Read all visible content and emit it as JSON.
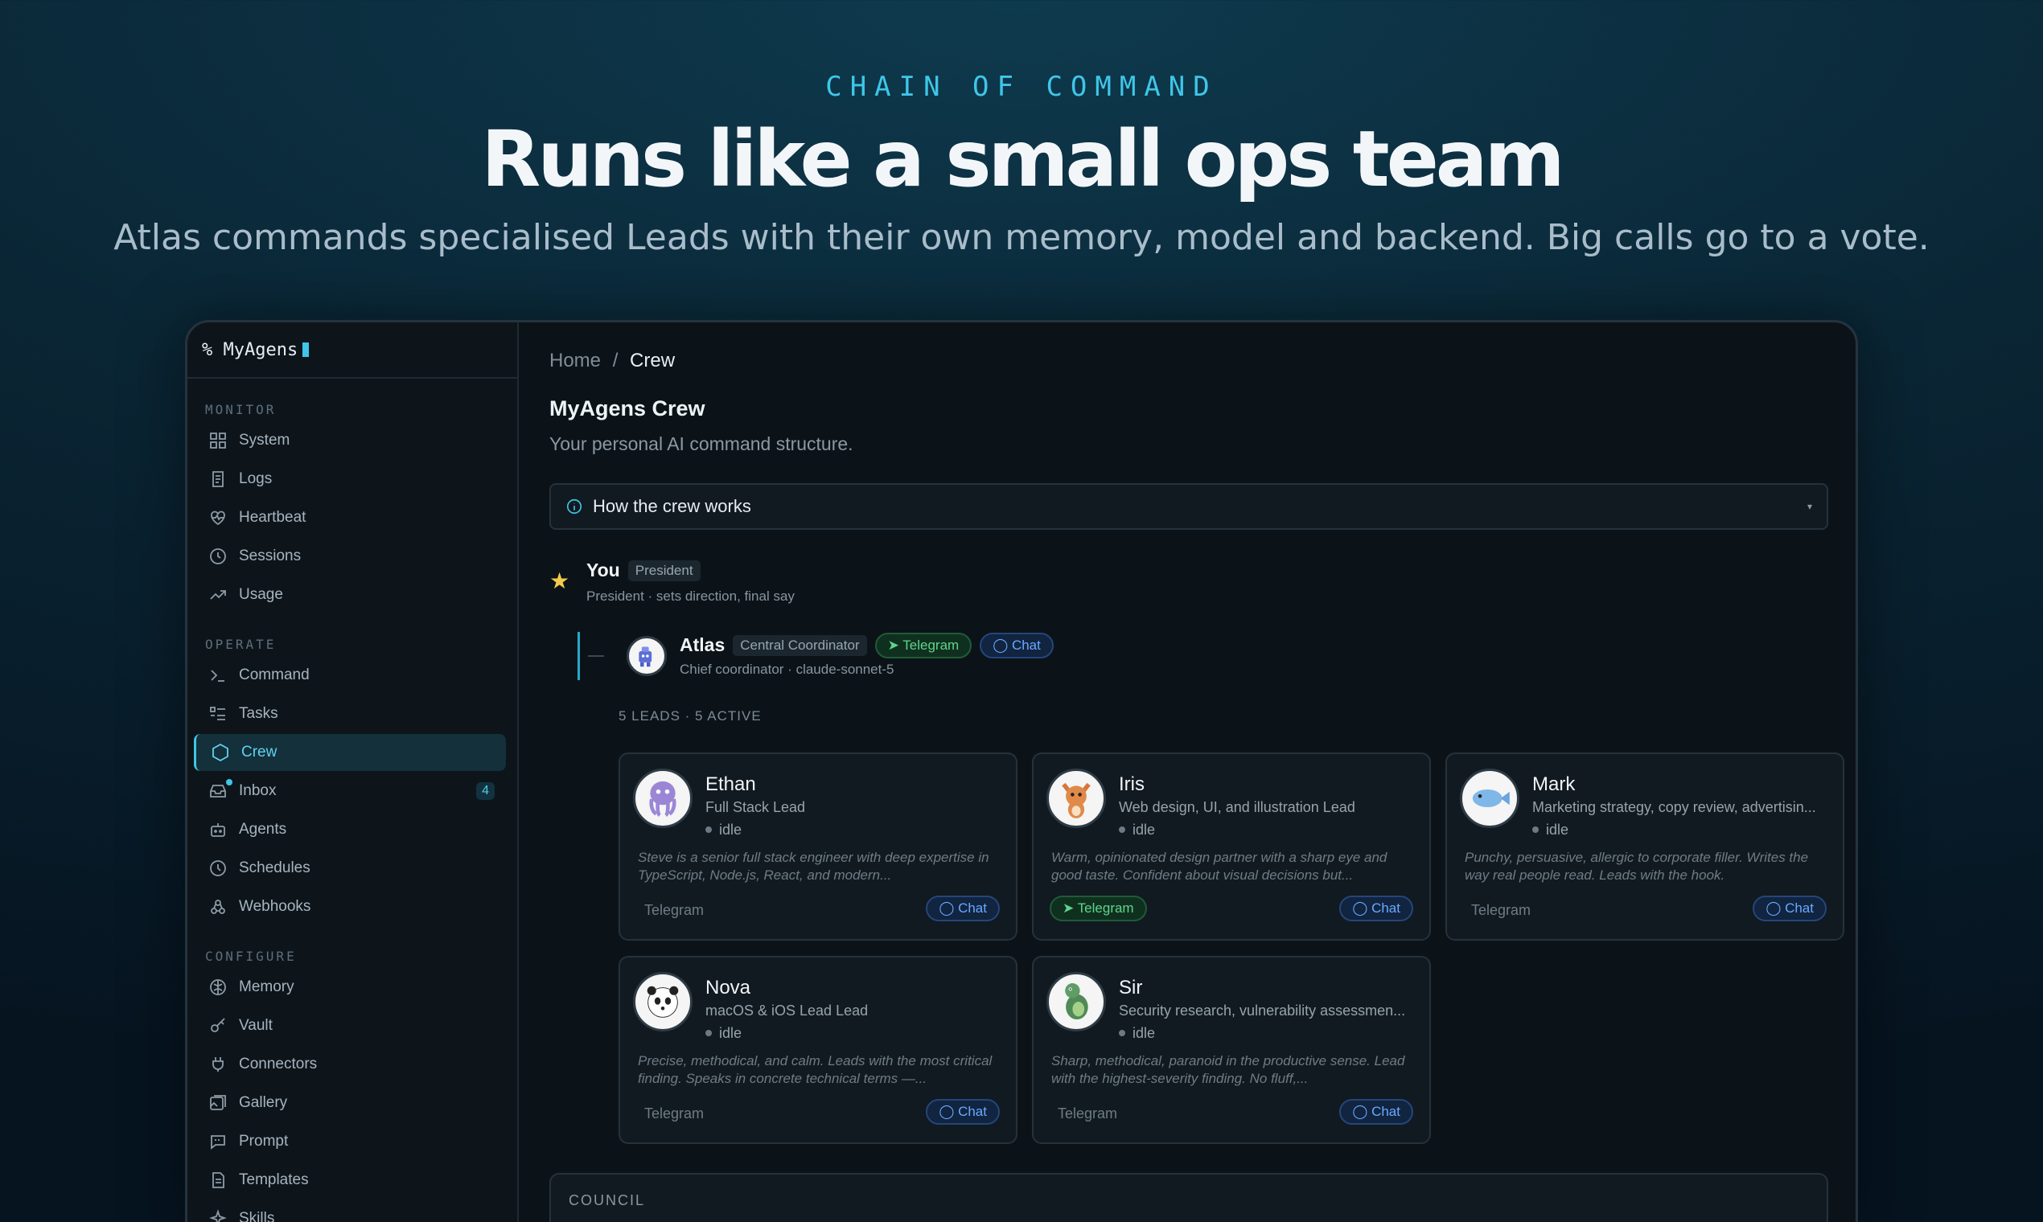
{
  "hero": {
    "eyebrow": "CHAIN OF COMMAND",
    "headline": "Runs like a small ops team",
    "subline": "Atlas commands specialised Leads with their own memory, model and backend. Big calls go to a vote."
  },
  "sidebar": {
    "brand": "% MyAgens",
    "sections": [
      {
        "label": "MONITOR",
        "items": [
          "System",
          "Logs",
          "Heartbeat",
          "Sessions",
          "Usage"
        ]
      },
      {
        "label": "OPERATE",
        "items": [
          "Command",
          "Tasks",
          "Crew",
          "Inbox",
          "Agents",
          "Schedules",
          "Webhooks"
        ]
      },
      {
        "label": "CONFIGURE",
        "items": [
          "Memory",
          "Vault",
          "Connectors",
          "Gallery",
          "Prompt",
          "Templates",
          "Skills"
        ]
      }
    ],
    "inbox_badge": "4",
    "active_item": "Crew"
  },
  "main": {
    "breadcrumb": {
      "home": "Home",
      "sep": "/",
      "current": "Crew"
    },
    "title": "MyAgens Crew",
    "subtitle": "Your personal AI command structure.",
    "accordion": {
      "label": "How the crew works",
      "caret": "▾"
    },
    "you": {
      "name": "You",
      "tag": "President",
      "sub": "President · sets direction, final say"
    },
    "atlas": {
      "name": "Atlas",
      "tag": "Central Coordinator",
      "telegram": "Telegram",
      "chat": "Chat",
      "sub": "Chief coordinator · claude-sonnet-5"
    },
    "leads_label": "5 LEADS · 5 ACTIVE",
    "leads": [
      {
        "name": "Ethan",
        "role": "Full Stack Lead",
        "status": "idle",
        "desc": "Steve is a senior full stack engineer with deep expertise in TypeScript, Node.js, React, and modern...",
        "telegram": "Telegram",
        "telegram_active": false,
        "chat": "Chat",
        "avatar": "octopus"
      },
      {
        "name": "Iris",
        "role": "Web design, UI, and illustration Lead",
        "status": "idle",
        "desc": "Warm, opinionated design partner with a sharp eye and good taste. Confident about visual decisions but...",
        "telegram": "Telegram",
        "telegram_active": true,
        "chat": "Chat",
        "avatar": "fox"
      },
      {
        "name": "Mark",
        "role": "Marketing strategy, copy review, advertisin...",
        "status": "idle",
        "desc": "Punchy, persuasive, allergic to corporate filler. Writes the way real people read. Leads with the hook.",
        "telegram": "Telegram",
        "telegram_active": false,
        "chat": "Chat",
        "avatar": "fish"
      },
      {
        "name": "Nova",
        "role": "macOS & iOS Lead Lead",
        "status": "idle",
        "desc": "Precise, methodical, and calm. Leads with the most critical finding. Speaks in concrete technical terms —...",
        "telegram": "Telegram",
        "telegram_active": false,
        "chat": "Chat",
        "avatar": "panda"
      },
      {
        "name": "Sir",
        "role": "Security research, vulnerability assessmen...",
        "status": "idle",
        "desc": "Sharp, methodical, paranoid in the productive sense. Lead with the highest-severity finding. No fluff,...",
        "telegram": "Telegram",
        "telegram_active": false,
        "chat": "Chat",
        "avatar": "turtle"
      }
    ],
    "council_label": "COUNCIL"
  },
  "colors": {
    "accent": "#3fc6e8",
    "telegram": "#5ed48c",
    "chat": "#69a9ff",
    "star": "#f2c94c"
  }
}
